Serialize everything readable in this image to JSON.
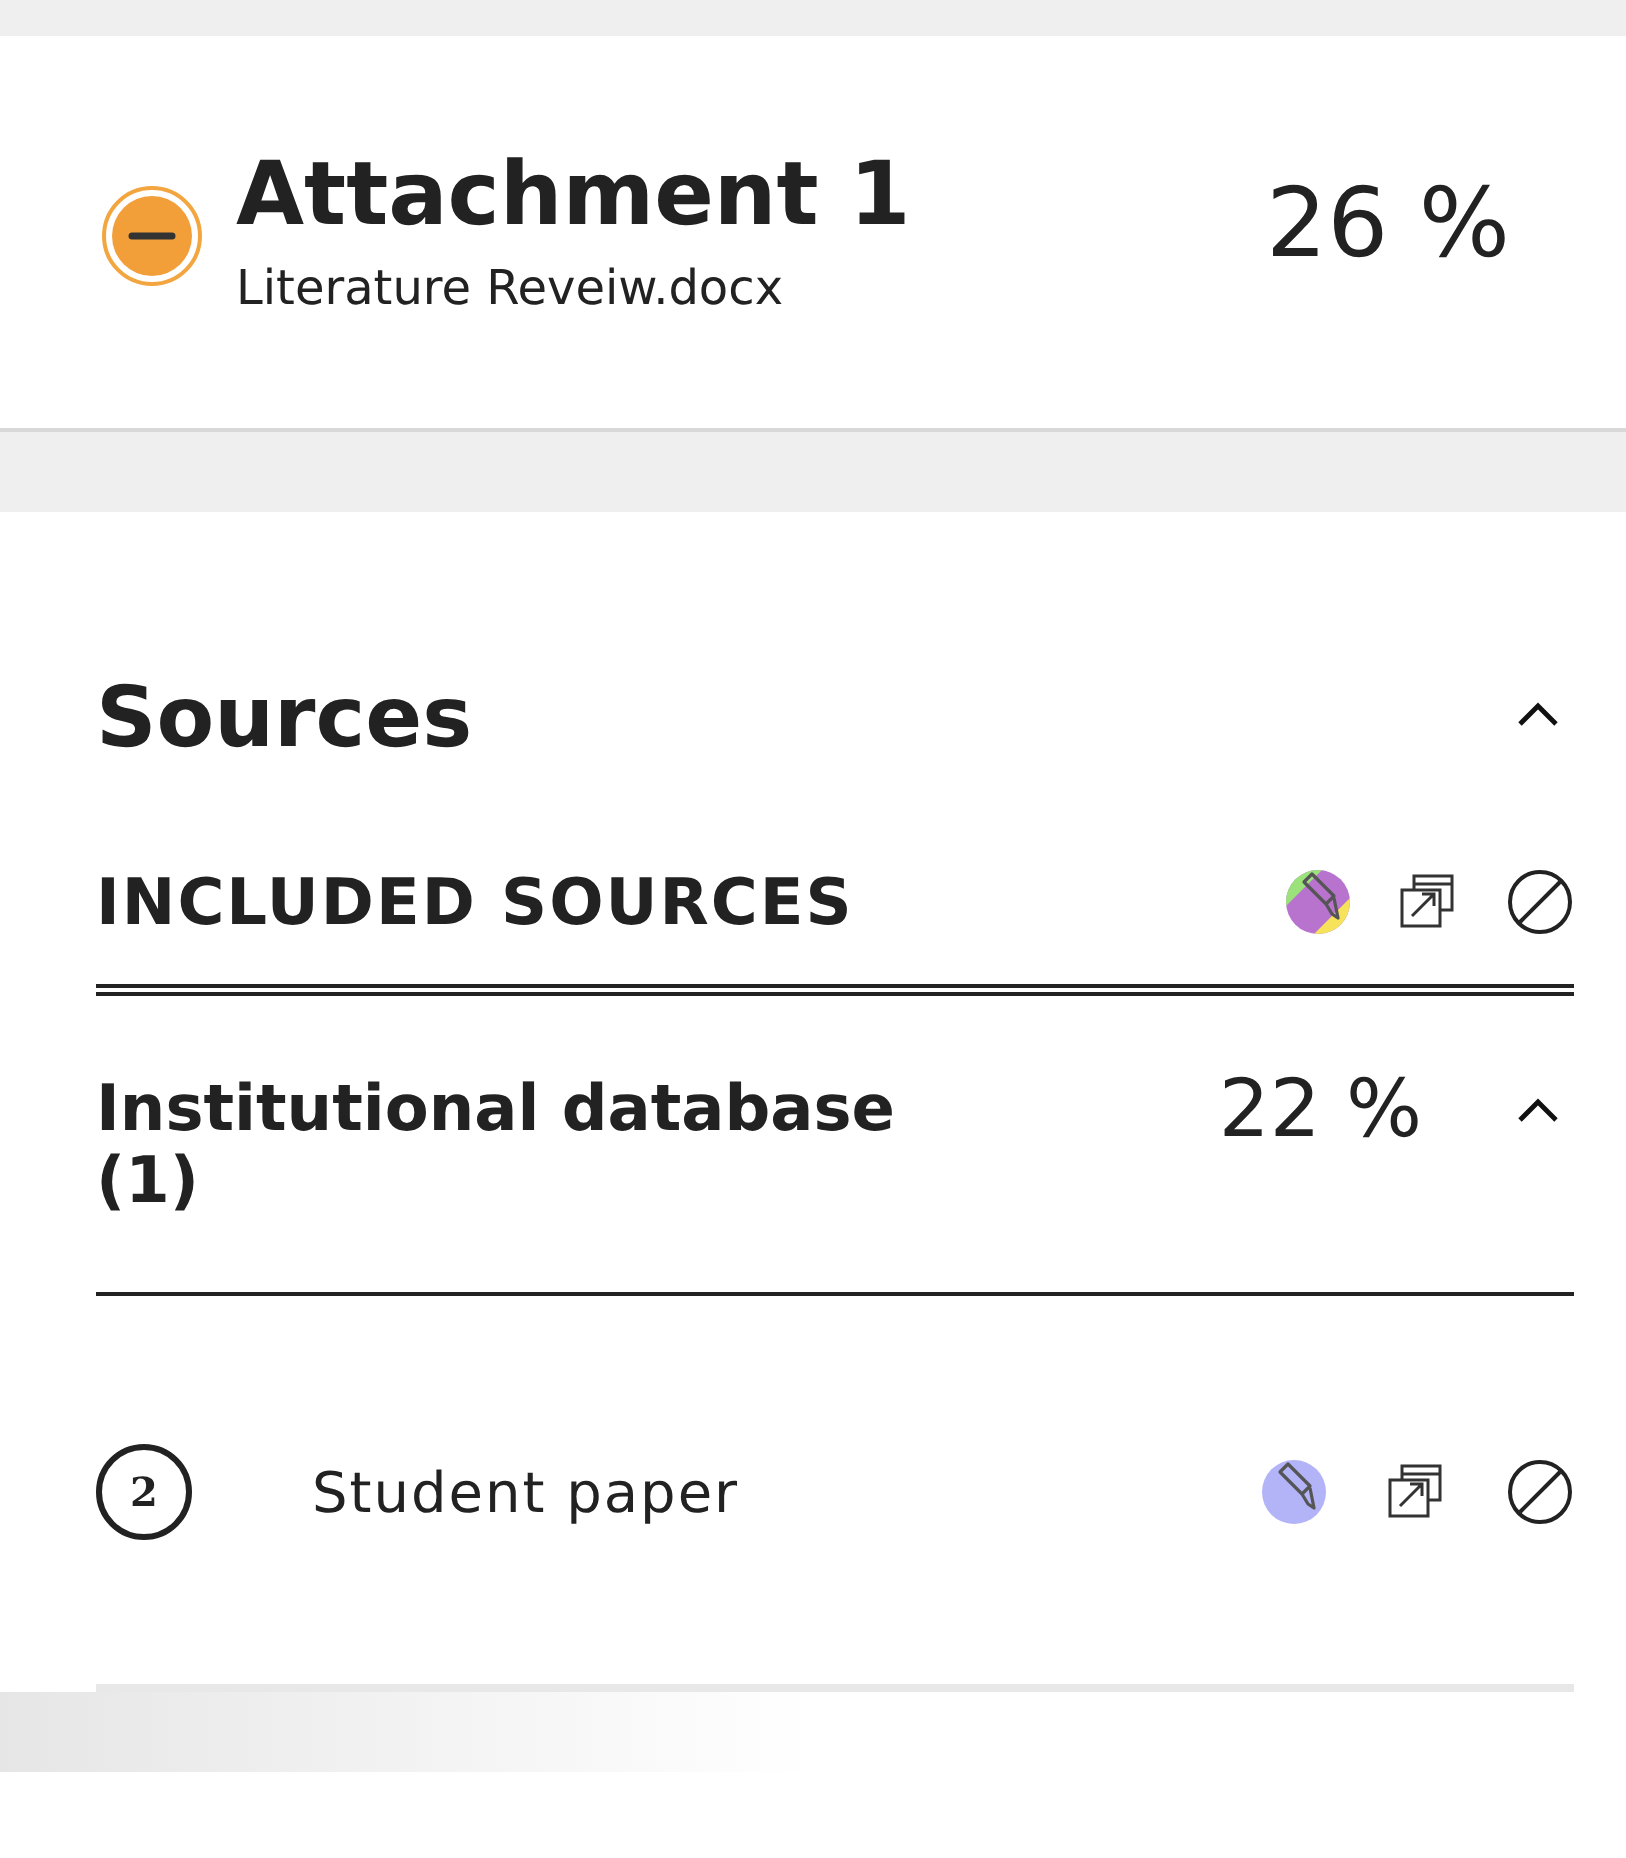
{
  "attachment": {
    "title": "Attachment 1",
    "filename": "Literature Reveiw.docx",
    "percentage": "26 %"
  },
  "sources": {
    "heading": "Sources",
    "expanded": true,
    "included_label": "INCLUDED SOURCES",
    "groups": [
      {
        "name": "Institutional database (1)",
        "percentage": "22 %",
        "expanded": true,
        "items": [
          {
            "number": "2",
            "name": "Student paper",
            "color": "#b3b3f7"
          }
        ]
      }
    ]
  }
}
